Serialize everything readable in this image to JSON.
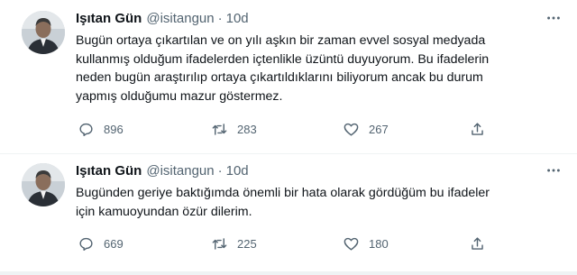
{
  "tweets": [
    {
      "author_name": "Işıtan Gün",
      "handle": "@isitangun",
      "separator": "·",
      "time": "10d",
      "text_lines": [
        "Bugün ortaya çıkartılan ve on yılı aşkın bir zaman evvel sosyal medyada",
        "kullanmış olduğum ifadelerden içtenlikle üzüntü duyuyorum. Bu ifadelerin",
        "neden bugün araştırılıp ortaya çıkartıldıklarını biliyorum ancak bu durum",
        "yapmış olduğumu mazur göstermez."
      ],
      "replies": "896",
      "retweets": "283",
      "likes": "267",
      "icons": {
        "avatar": "avatar",
        "more": "more-icon",
        "reply": "reply-icon",
        "retweet": "retweet-icon",
        "like": "heart-icon",
        "share": "share-icon"
      }
    },
    {
      "author_name": "Işıtan Gün",
      "handle": "@isitangun",
      "separator": "·",
      "time": "10d",
      "text_lines": [
        "Bugünden geriye baktığımda önemli bir hata olarak gördüğüm bu ifadeler",
        "için kamuoyundan özür dilerim."
      ],
      "replies": "669",
      "retweets": "225",
      "likes": "180",
      "icons": {
        "avatar": "avatar",
        "more": "more-icon",
        "reply": "reply-icon",
        "retweet": "retweet-icon",
        "like": "heart-icon",
        "share": "share-icon"
      }
    }
  ],
  "colors": {
    "text": "#0f1419",
    "secondary": "#536471",
    "divider": "#eff3f4"
  }
}
